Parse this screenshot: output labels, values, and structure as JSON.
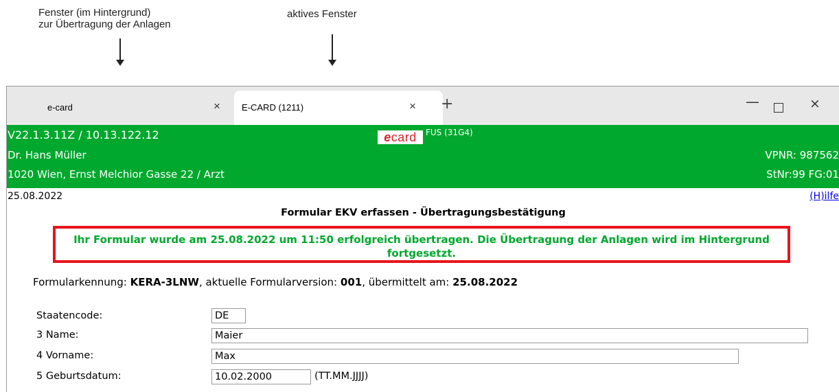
{
  "annotations": {
    "left_line1": "Fenster (im Hintergrund)",
    "left_line2": "zur Übertragung der Anlagen",
    "right": "aktives Fenster"
  },
  "browser": {
    "tabs": [
      {
        "title": "e-card",
        "close": "×"
      },
      {
        "title": "E-CARD (1211)",
        "close": "×"
      }
    ],
    "new_tab": "+",
    "minimize": "—",
    "close": "×"
  },
  "header": {
    "version": "V22.1.3.11Z / 10.13.122.12",
    "logo_e": "e",
    "logo_rest": "card",
    "fus": "FUS (31G4)",
    "doctor": "Dr. Hans Müller",
    "address": "1020 Wien, Ernst Melchior Gasse 22 / Arzt",
    "vpnr": "VPNR: 987562",
    "stnr": "StNr:99 FG:01",
    "bg_color": "#00a82d"
  },
  "page": {
    "date": "25.08.2022",
    "help": "(H)ilfe",
    "title": "Formular EKV erfassen - Übertragungsbestätigung",
    "success_message": "Ihr Formular wurde am 25.08.2022 um 11:50 erfolgreich übertragen. Die Übertragung der Anlagen wird im Hintergrund fortgesetzt.",
    "ident": {
      "label1": "Formularkennung: ",
      "value1": "KERA-3LNW",
      "label2": ", aktuelle Formularversion: ",
      "value2": "001",
      "label3": ", übermittelt am: ",
      "value3": "25.08.2022"
    }
  },
  "form": {
    "staatencode": {
      "label": "Staatencode:",
      "value": "DE"
    },
    "name": {
      "label": "3 Name:",
      "value": "Maier"
    },
    "vorname": {
      "label": "4 Vorname:",
      "value": "Max"
    },
    "geburtsdatum": {
      "label": "5 Geburtsdatum:",
      "value": "10.02.2000",
      "hint": "(TT.MM.JJJJ)"
    }
  }
}
